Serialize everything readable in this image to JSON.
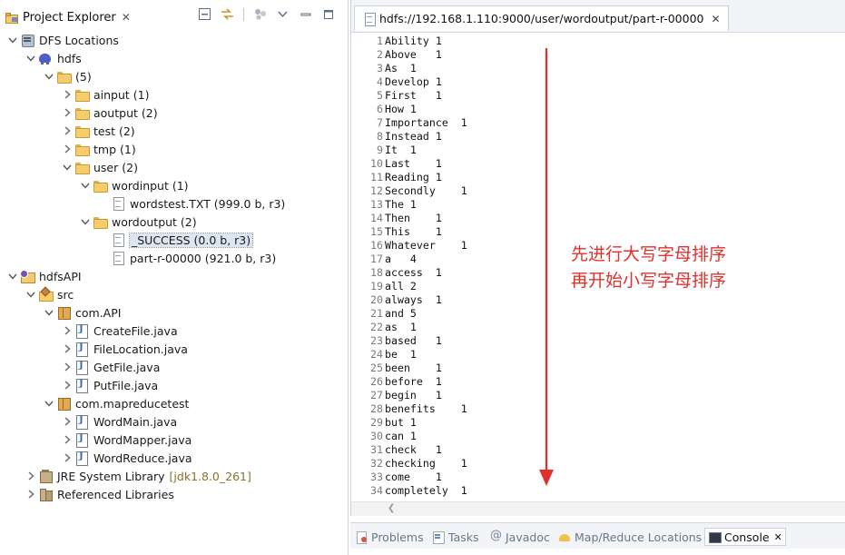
{
  "project_explorer": {
    "title": "Project Explorer",
    "close": "✕",
    "tree": [
      {
        "label": "DFS Locations",
        "icon": "db-icon",
        "depth": 0,
        "state": "expanded"
      },
      {
        "label": "hdfs",
        "icon": "elephant-icon",
        "depth": 1,
        "state": "expanded"
      },
      {
        "label": "(5)",
        "icon": "folder-icon",
        "depth": 2,
        "state": "expanded"
      },
      {
        "label": "ainput (1)",
        "icon": "folder-icon",
        "depth": 3,
        "state": "collapsed"
      },
      {
        "label": "aoutput (2)",
        "icon": "folder-icon",
        "depth": 3,
        "state": "collapsed"
      },
      {
        "label": "test (2)",
        "icon": "folder-icon",
        "depth": 3,
        "state": "collapsed"
      },
      {
        "label": "tmp (1)",
        "icon": "folder-icon",
        "depth": 3,
        "state": "collapsed"
      },
      {
        "label": "user (2)",
        "icon": "folder-icon",
        "depth": 3,
        "state": "expanded"
      },
      {
        "label": "wordinput (1)",
        "icon": "folder-icon",
        "depth": 4,
        "state": "expanded"
      },
      {
        "label": "wordstest.TXT (999.0 b, r3)",
        "icon": "file-icon",
        "depth": 5,
        "state": "leaf"
      },
      {
        "label": "wordoutput (2)",
        "icon": "folder-icon",
        "depth": 4,
        "state": "expanded"
      },
      {
        "label": "_SUCCESS (0.0 b, r3)",
        "icon": "file-icon",
        "depth": 5,
        "state": "leaf",
        "selected": true
      },
      {
        "label": "part-r-00000 (921.0 b, r3)",
        "icon": "file-icon",
        "depth": 5,
        "state": "leaf"
      },
      {
        "label": "hdfsAPI",
        "icon": "project-icon",
        "depth": 0,
        "state": "expanded"
      },
      {
        "label": "src",
        "icon": "source-folder-icon",
        "depth": 1,
        "state": "expanded"
      },
      {
        "label": "com.API",
        "icon": "package-icon",
        "depth": 2,
        "state": "expanded"
      },
      {
        "label": "CreateFile.java",
        "icon": "java-file-icon",
        "depth": 3,
        "state": "collapsed"
      },
      {
        "label": "FileLocation.java",
        "icon": "java-file-icon",
        "depth": 3,
        "state": "collapsed"
      },
      {
        "label": "GetFile.java",
        "icon": "java-file-icon",
        "depth": 3,
        "state": "collapsed"
      },
      {
        "label": "PutFile.java",
        "icon": "java-file-icon",
        "depth": 3,
        "state": "collapsed"
      },
      {
        "label": "com.mapreducetest",
        "icon": "package-icon",
        "depth": 2,
        "state": "expanded"
      },
      {
        "label": "WordMain.java",
        "icon": "java-file-icon",
        "depth": 3,
        "state": "collapsed"
      },
      {
        "label": "WordMapper.java",
        "icon": "java-file-icon",
        "depth": 3,
        "state": "collapsed"
      },
      {
        "label": "WordReduce.java",
        "icon": "java-file-icon",
        "depth": 3,
        "state": "collapsed"
      },
      {
        "label": "JRE System Library",
        "decoration": "[jdk1.8.0_261]",
        "icon": "jar-icon",
        "depth": 1,
        "state": "collapsed"
      },
      {
        "label": "Referenced Libraries",
        "icon": "libraries-icon",
        "depth": 1,
        "state": "collapsed"
      }
    ]
  },
  "editor": {
    "tab_title": "hdfs://192.168.1.110:9000/user/wordoutput/part-r-00000",
    "close": "✕",
    "lines": [
      "Ability 1",
      "Above   1",
      "As  1",
      "Develop 1",
      "First   1",
      "How 1",
      "Importance  1",
      "Instead 1",
      "It  1",
      "Last    1",
      "Reading 1",
      "Secondly    1",
      "The 1",
      "Then    1",
      "This    1",
      "Whatever    1",
      "a   4",
      "access  1",
      "all 2",
      "always  1",
      "and 5",
      "as  1",
      "based   1",
      "be  1",
      "been    1",
      "before  1",
      "begin   1",
      "benefits    1",
      "but 1",
      "can 1",
      "check   1",
      "checking    1",
      "come    1",
      "completely  1"
    ]
  },
  "annotation": {
    "line1": "先进行大写字母排序",
    "line2": "再开始小写字母排序",
    "color": "#e0312f"
  },
  "bottom_tabs": [
    {
      "label": "Problems",
      "icon": "problems-icon"
    },
    {
      "label": "Tasks",
      "icon": "tasks-icon"
    },
    {
      "label": "Javadoc",
      "icon": "javadoc-icon"
    },
    {
      "label": "Map/Reduce Locations",
      "icon": "elephant-icon"
    },
    {
      "label": "Console",
      "icon": "console-icon",
      "active": true,
      "close": "✕"
    }
  ]
}
